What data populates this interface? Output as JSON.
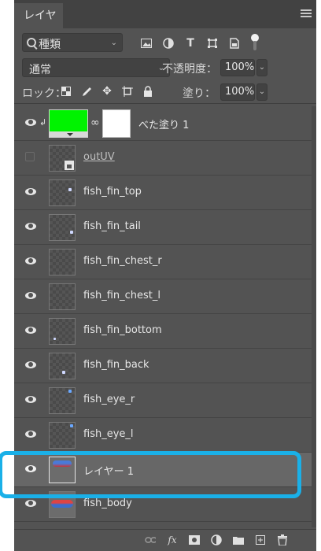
{
  "panel": {
    "tab_label": "レイヤー",
    "tab_close": "×",
    "menu_icon": "panel-menu-icon"
  },
  "filter": {
    "kind_label": "種類",
    "icons": [
      "image-filter-icon",
      "adjustment-filter-icon",
      "type-filter-icon",
      "shape-filter-icon",
      "smartobject-filter-icon"
    ]
  },
  "blend": {
    "mode": "通常",
    "opacity_label": "不透明度：",
    "opacity_value": "100%"
  },
  "lock": {
    "label": "ロック：",
    "fill_label": "塗り：",
    "fill_value": "100%"
  },
  "layers": [
    {
      "name": "べた塗り 1",
      "type": "fill",
      "visible": true,
      "fill_color": "#00f300",
      "mask_color": "#ffffff"
    },
    {
      "name": "outUV",
      "type": "smart-object",
      "visible": false
    },
    {
      "name": "fish_fin_top",
      "type": "pixel",
      "visible": true
    },
    {
      "name": "fish_fin_tail",
      "type": "pixel",
      "visible": true
    },
    {
      "name": "fish_fin_chest_r",
      "type": "pixel",
      "visible": true
    },
    {
      "name": "fish_fin_chest_l",
      "type": "pixel",
      "visible": true
    },
    {
      "name": "fish_fin_bottom",
      "type": "pixel",
      "visible": true
    },
    {
      "name": "fish_fin_back",
      "type": "pixel",
      "visible": true
    },
    {
      "name": "fish_eye_r",
      "type": "pixel",
      "visible": true
    },
    {
      "name": "fish_eye_l",
      "type": "pixel",
      "visible": true
    },
    {
      "name": "レイヤー 1",
      "type": "pixel",
      "visible": true,
      "selected": true
    },
    {
      "name": "fish_body",
      "type": "pixel",
      "visible": true
    }
  ],
  "highlight_color": "#1ab0e8",
  "bottom_icons": [
    "link-layers-icon",
    "fx-icon",
    "add-mask-icon",
    "adjustment-layer-icon",
    "new-group-icon",
    "new-layer-icon",
    "delete-icon"
  ],
  "bottom_fx_label": "fx"
}
